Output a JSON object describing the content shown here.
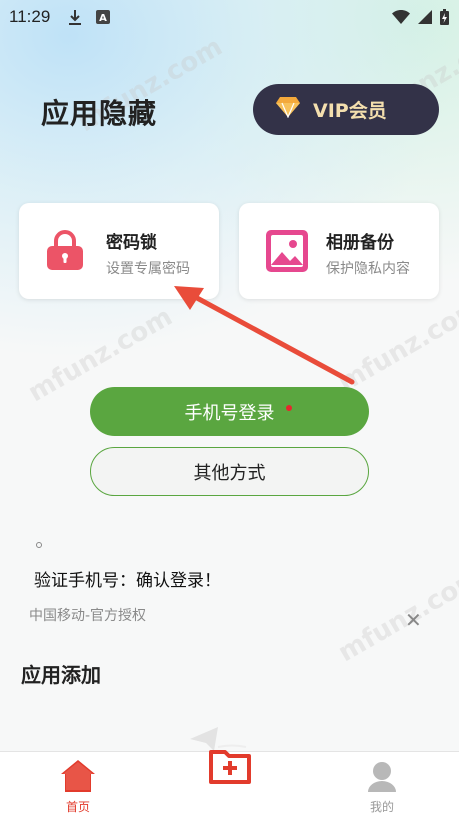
{
  "status_bar": {
    "time": "11:29",
    "icons": [
      "download-icon",
      "a-icon",
      "wifi-icon",
      "signal-icon",
      "battery-icon"
    ]
  },
  "header": {
    "title": "应用隐藏",
    "vip_label": "VIP会员"
  },
  "cards": [
    {
      "title": "密码锁",
      "subtitle": "设置专属密码",
      "icon": "lock-icon",
      "color": "#ec5467"
    },
    {
      "title": "相册备份",
      "subtitle": "保护隐私内容",
      "icon": "image-icon",
      "color": "#e6488f"
    }
  ],
  "login": {
    "phone_login_label": "手机号登录",
    "other_label": "其他方式",
    "verify_text": "验证手机号：确认登录！",
    "carrier_text": "中国移动-官方授权"
  },
  "section": {
    "title": "应用添加"
  },
  "tab_bar": {
    "home_label": "首页",
    "me_label": "我的"
  },
  "watermarks": [
    "mfunz.com",
    "mfunz.com",
    "mfunz.com",
    "mfunz.com",
    "mfunz.com"
  ],
  "colors": {
    "accent_green": "#5aa640",
    "vip_bg": "#333248",
    "active_red": "#e23b2c",
    "arrow_red": "#e94c3a"
  }
}
